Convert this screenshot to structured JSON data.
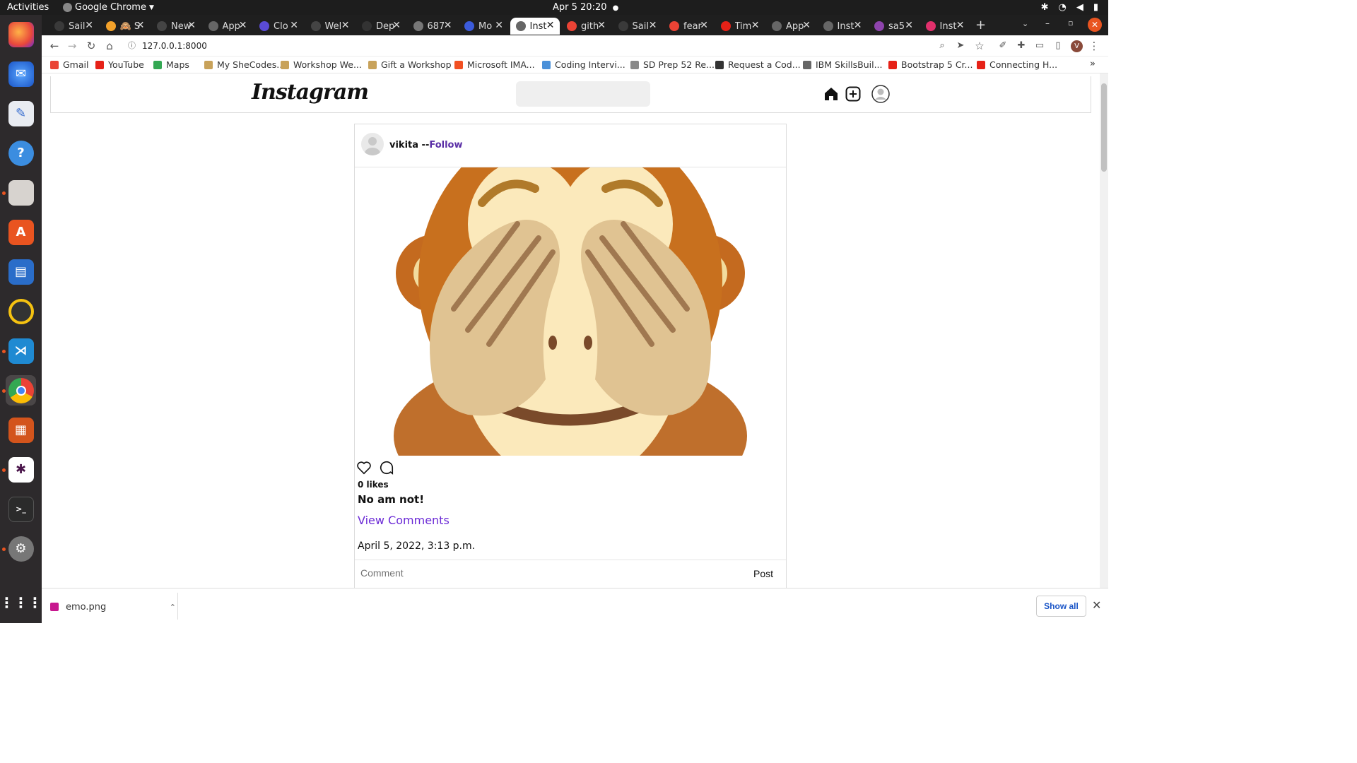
{
  "system": {
    "activities": "Activities",
    "app_name": "Google Chrome",
    "clock": "Apr 5  20:20"
  },
  "tabs": [
    {
      "label": "Sail",
      "color": "#3a3a3a"
    },
    {
      "label": "🙈 S",
      "color": "#f2a12a"
    },
    {
      "label": "New",
      "color": "#444"
    },
    {
      "label": "App",
      "color": "#666"
    },
    {
      "label": "Clo",
      "color": "#5a4bd6"
    },
    {
      "label": "Wel",
      "color": "#444"
    },
    {
      "label": "Dep",
      "color": "#333"
    },
    {
      "label": "687",
      "color": "#777"
    },
    {
      "label": "Mo",
      "color": "#3b5bdb"
    },
    {
      "label": "Inst",
      "color": "#666",
      "selected": true
    },
    {
      "label": "gith",
      "color": "#ea4335"
    },
    {
      "label": "Sail",
      "color": "#3a3a3a"
    },
    {
      "label": "fear",
      "color": "#ea4335"
    },
    {
      "label": "Tim",
      "color": "#e62117"
    },
    {
      "label": "App",
      "color": "#666"
    },
    {
      "label": "Inst",
      "color": "#666"
    },
    {
      "label": "sa5",
      "color": "#8e44ad"
    },
    {
      "label": "Inst",
      "color": "#e1306c"
    }
  ],
  "address": {
    "url": "127.0.0.1:8000"
  },
  "bookmarks": [
    {
      "label": "Gmail",
      "color": "#ea4335"
    },
    {
      "label": "YouTube",
      "color": "#e62117"
    },
    {
      "label": "Maps",
      "color": "#34a853"
    },
    {
      "label": "My SheCodes...",
      "color": "#c8a25a"
    },
    {
      "label": "Workshop We...",
      "color": "#c8a25a"
    },
    {
      "label": "Gift a Workshop",
      "color": "#c8a25a"
    },
    {
      "label": "Microsoft IMA...",
      "color": "#f25022"
    },
    {
      "label": "Coding Intervi...",
      "color": "#4a90d9"
    },
    {
      "label": "SD Prep 52 Re...",
      "color": "#888"
    },
    {
      "label": "Request a Cod...",
      "color": "#333"
    },
    {
      "label": "IBM SkillsBuil...",
      "color": "#666"
    },
    {
      "label": "Bootstrap 5 Cr...",
      "color": "#e62117"
    },
    {
      "label": "Connecting H...",
      "color": "#e62117"
    }
  ],
  "app": {
    "logo": "Instagram",
    "search_placeholder": ""
  },
  "post": {
    "username": "vikita",
    "separator": " --",
    "follow": "Follow",
    "likes": "0 likes",
    "caption": "No am not!",
    "view_comments": "View Comments",
    "date": "April 5, 2022, 3:13 p.m.",
    "comment_placeholder": "Comment",
    "post_button": "Post"
  },
  "downloads": {
    "file": "emo.png",
    "show_all": "Show all"
  }
}
